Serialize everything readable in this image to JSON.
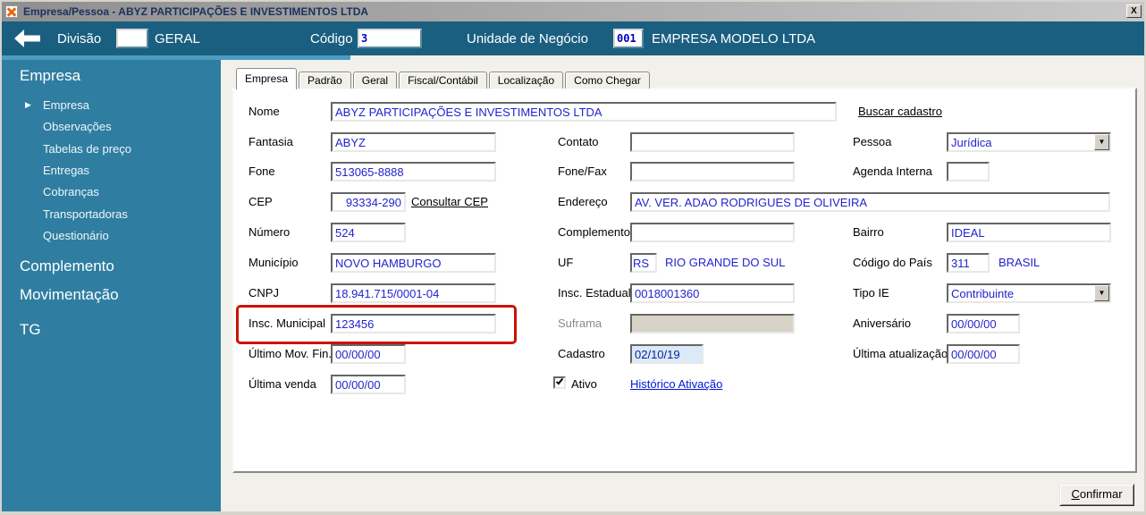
{
  "window": {
    "title": "Empresa/Pessoa - ABYZ PARTICIPAÇÕES E INVESTIMENTOS LTDA",
    "close_glyph": "X"
  },
  "icons": {
    "dropdown_arrow": "▼",
    "selected_item_arrow": "▶"
  },
  "header": {
    "division_label": "Divisão",
    "division_code": "",
    "division_name": "GERAL",
    "code_label": "Código",
    "code_value": "3",
    "unit_label": "Unidade de Negócio",
    "unit_code": "001",
    "unit_name": "EMPRESA MODELO LTDA"
  },
  "sidebar": {
    "sections": [
      {
        "label": "Empresa",
        "items": [
          {
            "label": "Empresa",
            "selected": true
          },
          {
            "label": "Observações"
          },
          {
            "label": "Tabelas de preço"
          },
          {
            "label": "Entregas"
          },
          {
            "label": "Cobranças"
          },
          {
            "label": "Transportadoras"
          },
          {
            "label": "Questionário"
          }
        ]
      },
      {
        "label": "Complemento",
        "items": []
      },
      {
        "label": "Movimentação",
        "items": []
      },
      {
        "label": "TG",
        "items": []
      }
    ]
  },
  "tabs": {
    "active": "Empresa",
    "items": [
      "Empresa",
      "Padrão",
      "Geral",
      "Fiscal/Contábil",
      "Localização",
      "Como Chegar"
    ]
  },
  "form": {
    "nome": {
      "label": "Nome",
      "value": "ABYZ PARTICIPAÇÕES E INVESTIMENTOS LTDA"
    },
    "buscar_cadastro": "Buscar cadastro",
    "fantasia": {
      "label": "Fantasia",
      "value": "ABYZ"
    },
    "contato": {
      "label": "Contato",
      "value": ""
    },
    "pessoa": {
      "label": "Pessoa",
      "value": "Jurídica"
    },
    "fone": {
      "label": "Fone",
      "value": "513065-8888"
    },
    "fone_fax": {
      "label": "Fone/Fax",
      "value": ""
    },
    "agenda_interna": {
      "label": "Agenda Interna",
      "value": ""
    },
    "cep": {
      "label": "CEP",
      "value": "93334-290"
    },
    "consultar_cep": "Consultar CEP",
    "endereco": {
      "label": "Endereço",
      "value": "AV. VER. ADAO RODRIGUES DE OLIVEIRA"
    },
    "numero": {
      "label": "Número",
      "value": "524"
    },
    "complemento": {
      "label": "Complemento",
      "value": ""
    },
    "bairro": {
      "label": "Bairro",
      "value": "IDEAL"
    },
    "municipio": {
      "label": "Município",
      "value": "NOVO HAMBURGO"
    },
    "uf": {
      "label": "UF",
      "value": "RS",
      "name": "RIO GRANDE DO SUL"
    },
    "codigo_pais": {
      "label": "Código do País",
      "value": "311",
      "name": "BRASIL"
    },
    "cnpj": {
      "label": "CNPJ",
      "value": "18.941.715/0001-04"
    },
    "insc_estadual": {
      "label": "Insc. Estadual",
      "value": "0018001360"
    },
    "tipo_ie": {
      "label": "Tipo IE",
      "value": "Contribuinte"
    },
    "insc_municipal": {
      "label": "Insc. Municipal",
      "value": "123456"
    },
    "suframa": {
      "label": "Suframa",
      "value": "",
      "disabled": true
    },
    "aniversario": {
      "label": "Aniversário",
      "value": "00/00/00"
    },
    "ultimo_mov_fin": {
      "label": "Último Mov. Fin.",
      "value": "00/00/00"
    },
    "cadastro": {
      "label": "Cadastro",
      "value": "02/10/19"
    },
    "ultima_atualizacao": {
      "label": "Última atualização",
      "value": "00/00/00"
    },
    "ultima_venda": {
      "label": "Última venda",
      "value": "00/00/00"
    },
    "ativo": {
      "label": "Ativo",
      "checked": true
    },
    "historico_ativacao": "Histórico Ativação"
  },
  "footer": {
    "confirm": "Confirmar"
  },
  "colors": {
    "header_teal": "#1A5F80",
    "sidebar_teal": "#2F7EA1",
    "accent_light": "#4C9BC1",
    "highlight_red": "#CC1100",
    "value_blue": "#2323CF"
  }
}
